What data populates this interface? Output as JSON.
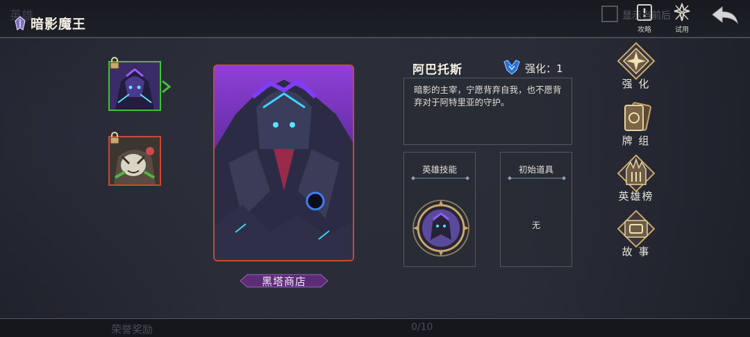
{
  "header": {
    "title": "暗影魔王",
    "ghost_tab": "英雄",
    "ghost_checkbox_label": "显示当前后",
    "guide_label": "攻略",
    "trial_label": "试用"
  },
  "heroes": [
    {
      "name": "hero-slot-1",
      "selected": true,
      "locked": true
    },
    {
      "name": "hero-slot-2",
      "selected": false,
      "locked": true
    }
  ],
  "card": {
    "shop_label": "黑塔商店"
  },
  "info": {
    "hero_name": "阿巴托斯",
    "enhance_label": "强化：1",
    "description": "暗影的主宰，宁愿背弃自我，也不愿背弃对于阿特里亚的守护。",
    "skill_title": "英雄技能",
    "item_title": "初始道具",
    "item_value": "无"
  },
  "menu": [
    {
      "id": "enhance",
      "label": "强  化"
    },
    {
      "id": "deck",
      "label": "牌  组"
    },
    {
      "id": "ranking",
      "label": "英雄榜"
    },
    {
      "id": "story",
      "label": "故  事"
    }
  ],
  "bottom": {
    "honor_label": "荣誉奖励",
    "progress": "0/10"
  },
  "colors": {
    "selected_border": "#44c23a",
    "card_border": "#c8493c",
    "gold": "#c9a86a"
  }
}
